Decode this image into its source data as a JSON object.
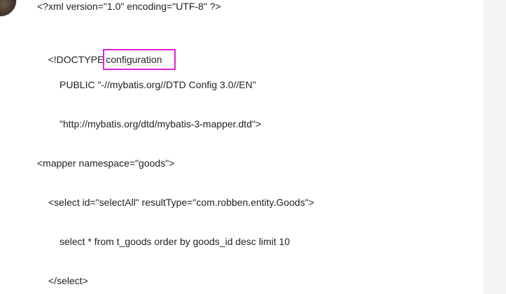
{
  "code": {
    "line1": "<?xml version=\"1.0\" encoding=\"UTF-8\" ?>",
    "line2_prefix": "<!DOCTYPE",
    "line2_highlight": "configuration",
    "line3": "PUBLIC \"-//mybatis.org//DTD Config 3.0//EN\"",
    "line4": "\"http://mybatis.org/dtd/mybatis-3-mapper.dtd\">",
    "line5": "<mapper namespace=\"goods\">",
    "line6": "<select id=\"selectAll\" resultType=\"com.robben.entity.Goods\">",
    "line7": "select * from t_goods order by goods_id desc limit 10",
    "line8": "</select>"
  },
  "colors": {
    "highlight_border": "#e11fd6",
    "text": "#222222",
    "background": "#ffffff"
  }
}
